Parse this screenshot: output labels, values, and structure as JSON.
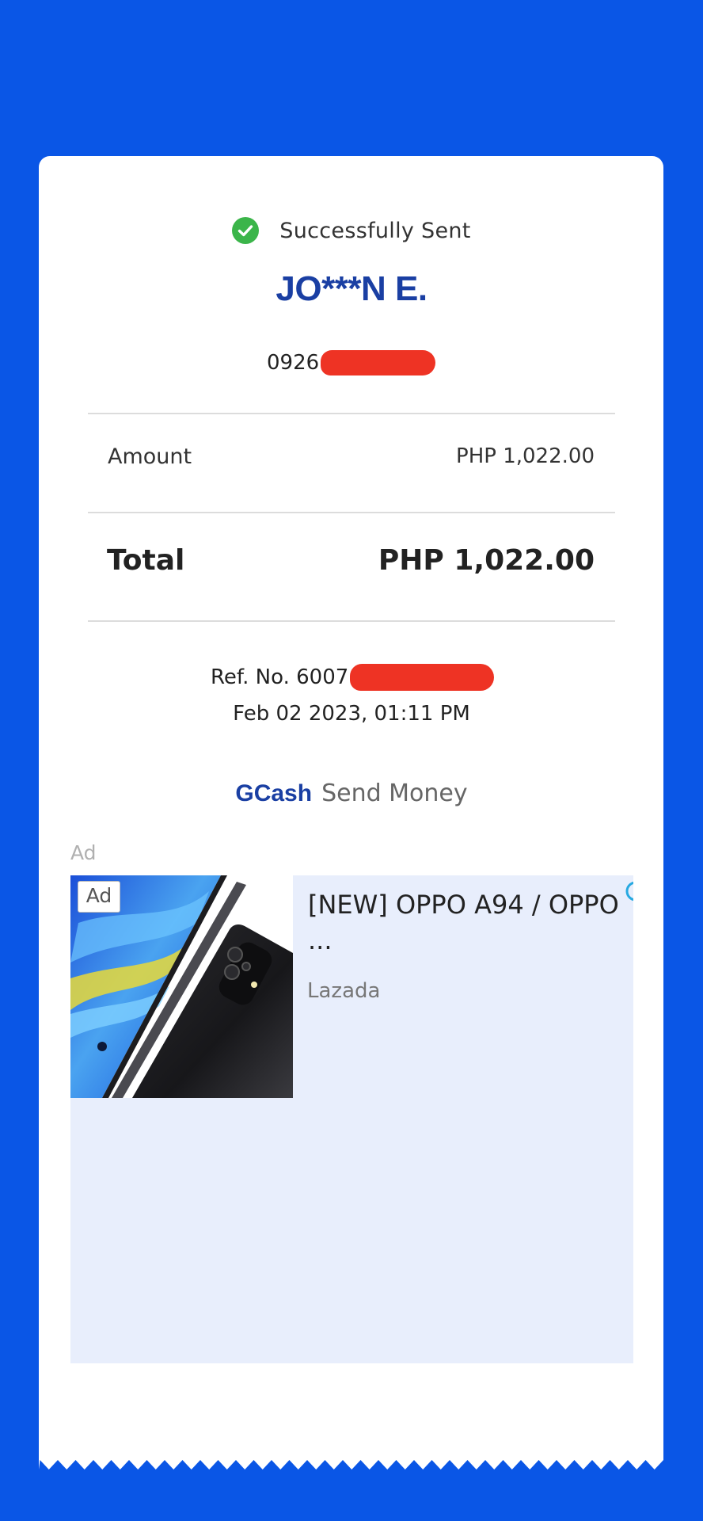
{
  "receipt": {
    "status": "Successfully Sent",
    "recipient_name": "JO***N E.",
    "phone_prefix": "0926",
    "amount_label": "Amount",
    "amount_value": "PHP 1,022.00",
    "total_label": "Total",
    "total_value": "PHP 1,022.00",
    "ref_prefix": "Ref. No. 6007",
    "datetime": "Feb 02 2023, 01:11 PM",
    "brand": "GCash",
    "service": "Send Money"
  },
  "ad": {
    "label": "Ad",
    "badge": "Ad",
    "title": "[NEW] OPPO A94 / OPPO ...",
    "source": "Lazada"
  },
  "colors": {
    "background": "#0a56e6",
    "brand_blue": "#1a3fa3",
    "success_green": "#3bb54a",
    "redaction_red": "#ee3324",
    "ad_background": "#e8eefc"
  },
  "icons": {
    "status": "check-circle-icon",
    "ad_choice": "adchoices-icon"
  }
}
